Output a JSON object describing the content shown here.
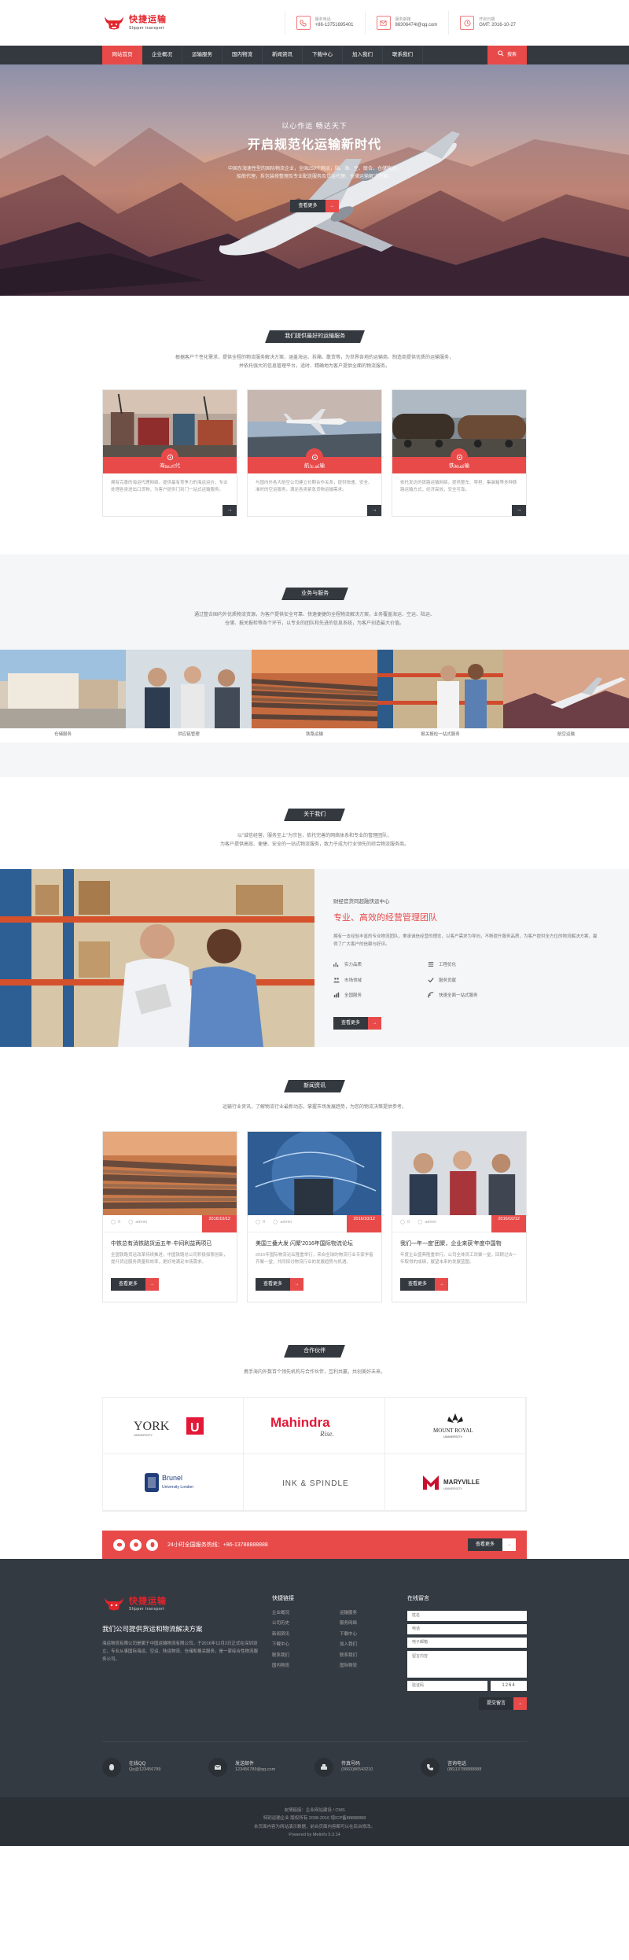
{
  "brand": {
    "name_cn": "快捷运输",
    "name_en": "Slipper transport"
  },
  "header": {
    "contacts": [
      {
        "icon": "phone-icon",
        "label": "服务电话",
        "value": "+86-13751695401"
      },
      {
        "icon": "mail-icon",
        "label": "服务邮箱",
        "value": "86306474l@qq.com"
      },
      {
        "icon": "clock-icon",
        "label": "开启日期",
        "value": "GMT: 2016-10-27"
      }
    ]
  },
  "nav": {
    "items": [
      "网站首页",
      "企业概况",
      "运输服务",
      "国内物流",
      "新闻资讯",
      "下载中心",
      "加入我们",
      "联系我们"
    ],
    "search": "搜索"
  },
  "hero": {
    "subtitle": "以心作运 畅达天下",
    "title": "开启规范化运输新时代",
    "desc": "中国东海速性型的国际物流企业，全国250个网点，陆、海、空、联合、仓储物流，\n船舶代理，拆包装修整理及专业配送服务及货运代理、仓储运输解决方案。",
    "button": "查看更多"
  },
  "services": {
    "title": "我们提供最好的运输服务",
    "desc": "根据客户个性化需求，提供全程的物流服务解决方案，涵盖海运、拆箱、散货等，为世界各地的运输商、制造商提供优质的运输服务，\n并依托强大的信息管理平台，适时、精确地为客户提供全面的物流服务。",
    "cards": [
      {
        "title": "海运货代",
        "desc": "拥有完善的海运代理网络，提供最有竞争力的海运运价，专业处理各类进出口货物，为客户提供门到门一站式运输服务。",
        "more": "→"
      },
      {
        "title": "航空运输",
        "desc": "与国内外各大航空公司建立长期合作关系，提供快速、安全、准时的空运服务，满足各类紧急货物运输需求。",
        "more": "→"
      },
      {
        "title": "铁路运输",
        "desc": "依托发达的铁路运输网络，提供整车、零担、集装箱等多种铁路运输方式，经济高效，安全可靠。",
        "more": "→"
      }
    ]
  },
  "business": {
    "title": "业务与服务",
    "desc": "通过整合国内外优质物流资源，为客户提供安全可靠、快速便捷的全程物流解决方案，业务覆盖海运、空运、陆运、\n仓储、报关报检等各个环节，以专业的团队和先进的信息系统，为客户创造最大价值。",
    "items": [
      "仓储服务",
      "供应链管理",
      "铁路运输",
      "报关报检一站式服务",
      "航空运输"
    ]
  },
  "about": {
    "title": "关于我们",
    "desc": "以\"诚信经营，服务至上\"为宗旨，依托完善的网络体系和专业的管理团队，\n为客户提供高效、便捷、安全的一站式物流服务，致力于成为行业领先的综合物流服务商。",
    "subtitle": "财经官货同超融快运中心",
    "heading": "专业、高效的经营管理团队",
    "text": "拥有一支经验丰富的专业物流团队，秉承诚信经营的理念，以客户需求为导向，不断提升服务品质，为客户提供全方位的物流解决方案，赢得了广大客户的信赖与好评。",
    "features": [
      {
        "icon": "chart-icon",
        "label": "实力品质"
      },
      {
        "icon": "list-icon",
        "label": "工程优化"
      },
      {
        "icon": "team-icon",
        "label": "市场领域"
      },
      {
        "icon": "check-icon",
        "label": "服务贡献"
      },
      {
        "icon": "bar-icon",
        "label": "全国服务"
      },
      {
        "icon": "globe-icon",
        "label": "快速全面一站式服务"
      }
    ],
    "button": "查看更多"
  },
  "news": {
    "title": "新闻资讯",
    "desc": "运输行业资讯，了解物流行业最新动态，掌握市场发展趋势，为您的物流决策提供参考。",
    "items": [
      {
        "comments": "0",
        "author": "admin",
        "date": "2016/10/12",
        "title": "中铁总有消铁路货运五年·中间利益两项已",
        "desc": "全国铁路货运改革持续推进，中国铁路总公司积极探索创新，提升货运服务质量和效率，更好地满足市场需求。",
        "button": "查看更多"
      },
      {
        "comments": "0",
        "author": "admin",
        "date": "2016/10/12",
        "title": "美国三叠大发 闪聚'2016年国际物流论坛",
        "desc": "2016年国际物流论坛隆重举行，来自全球的物流行业专家学者齐聚一堂，共同探讨物流行业的发展趋势与机遇。",
        "button": "查看更多"
      },
      {
        "comments": "0",
        "author": "admin",
        "date": "2016/10/12",
        "title": "我们一年一度'团聚，企业来获'年度中国物",
        "desc": "年度企业盛典隆重举行，公司全体员工欢聚一堂，回顾过去一年取得的成绩，展望未来的发展蓝图。",
        "button": "查看更多"
      }
    ]
  },
  "partners": {
    "title": "合作伙伴",
    "desc": "携手海内外数百个领先机构与合作伙伴，互利共赢，共创美好未来。",
    "logos": [
      {
        "name": "York University",
        "text": "YORK",
        "sub": "UNIVERSITY"
      },
      {
        "name": "Mahindra Rise",
        "text": "Mahindra",
        "sub": "Rise."
      },
      {
        "name": "Mount Royal University",
        "text": "MOUNT ROYAL",
        "sub": "UNIVERSITY"
      },
      {
        "name": "Brunel University London",
        "text": "Brunel",
        "sub": "University London"
      },
      {
        "name": "Ink & Spindle",
        "text": "INK & SPINDLE",
        "sub": ""
      },
      {
        "name": "Maryville University",
        "text": "MARYVILLE",
        "sub": "UNIVERSITY"
      }
    ]
  },
  "phonebar": {
    "text": "24小时全国服务热线：+86-13788888888",
    "button": "查看更多"
  },
  "footer": {
    "about_title": "我们公司提供货运和物流解决方案",
    "about_text": "海运物流有限公司是属于中国运输物流有限公司，于2016年12月2日正式在深圳设立，专业从事国际海运、空运、陆运物流、仓储和报关服务，是一家综合性物流服务公司。",
    "links_title": "快捷链接",
    "links": [
      "企业概况",
      "运输服务",
      "公司历史",
      "服务网络",
      "新闻资讯",
      "下载中心",
      "下载中心",
      "加入我们",
      "联系我们",
      "联系我们",
      "国内物流",
      "国际物流"
    ],
    "form_title": "在线留言",
    "form_fields": [
      "姓名",
      "电话",
      "电子邮箱",
      "留言内容"
    ],
    "captcha_placeholder": "验证码",
    "captcha_code": "1264",
    "submit": "提交留言",
    "contacts": [
      {
        "icon": "qq-icon",
        "label": "在线QQ",
        "value": "Qq@123456789"
      },
      {
        "icon": "mail-icon",
        "label": "发送邮件",
        "value": "123456789@qq.com"
      },
      {
        "icon": "fax-icon",
        "label": "传真号码",
        "value": "(0663)86543210"
      },
      {
        "icon": "phone-icon",
        "label": "咨询电话",
        "value": "(86)13788888888"
      }
    ],
    "copyright": [
      "友情链接：企业网站建设 / CMS",
      "特别运输企业 版权所有 2008-2016 增ICP备88888888",
      "本页面内容为网站演示数据，前台页面内容都可以在后台修改。",
      "Powered by Metinfo 5.3.14"
    ]
  },
  "colors": {
    "accent": "#e84a4a",
    "dark": "#34393f"
  }
}
